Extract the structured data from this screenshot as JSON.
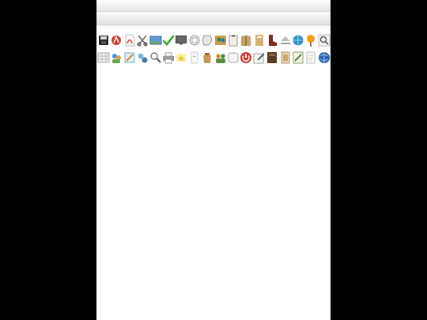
{
  "window": {},
  "toolbar": {
    "row1": [
      "save-icon",
      "acrobat-icon",
      "pdf-icon",
      "cut-icon",
      "image-icon",
      "check-icon",
      "monitor-icon",
      "page-icon",
      "stamp-icon",
      "group-icon",
      "clipboard-icon",
      "package-icon",
      "box-icon",
      "boot-icon",
      "eject-icon",
      "globe-icon",
      "lollipop-icon",
      "search-icon"
    ],
    "row2": [
      "table-icon",
      "users-icon",
      "tools-icon",
      "gears-icon",
      "zoom-icon",
      "printer-icon",
      "star-icon",
      "note-icon",
      "bag-icon",
      "people-icon",
      "frame-icon",
      "power-icon",
      "edit-icon",
      "book-icon",
      "folder-icon",
      "form-icon",
      "document-icon",
      "earth-icon"
    ]
  },
  "colors": {
    "background": "#000000",
    "panel": "#ffffff",
    "bar_light": "#fdfdfd",
    "bar_dark": "#e2e2e2"
  }
}
